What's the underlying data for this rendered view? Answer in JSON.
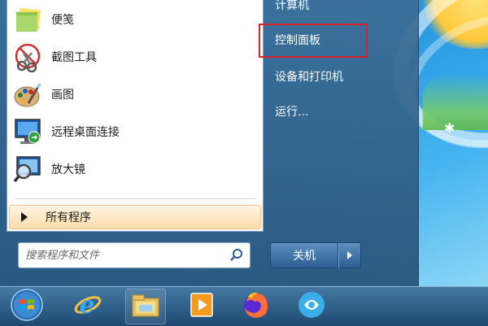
{
  "start_menu": {
    "programs": [
      {
        "label": "便笺",
        "icon": "sticky-notes-icon"
      },
      {
        "label": "截图工具",
        "icon": "snipping-tool-icon"
      },
      {
        "label": "画图",
        "icon": "paint-icon"
      },
      {
        "label": "远程桌面连接",
        "icon": "remote-desktop-icon"
      },
      {
        "label": "放大镜",
        "icon": "magnifier-icon"
      }
    ],
    "all_programs_label": "所有程序",
    "search_placeholder": "搜索程序和文件",
    "right_items": [
      {
        "label": "计算机"
      },
      {
        "label": "控制面板"
      },
      {
        "label": "设备和打印机"
      },
      {
        "label": "运行..."
      }
    ],
    "shutdown_label": "关机",
    "highlighted_item": "控制面板",
    "highlight_color": "#d9222c"
  },
  "taskbar": {
    "items": [
      {
        "icon": "windows-start-orb-icon"
      },
      {
        "icon": "internet-explorer-icon"
      },
      {
        "icon": "file-explorer-icon"
      },
      {
        "icon": "media-player-icon"
      },
      {
        "icon": "firefox-icon"
      },
      {
        "icon": "app-circle-icon"
      }
    ]
  }
}
